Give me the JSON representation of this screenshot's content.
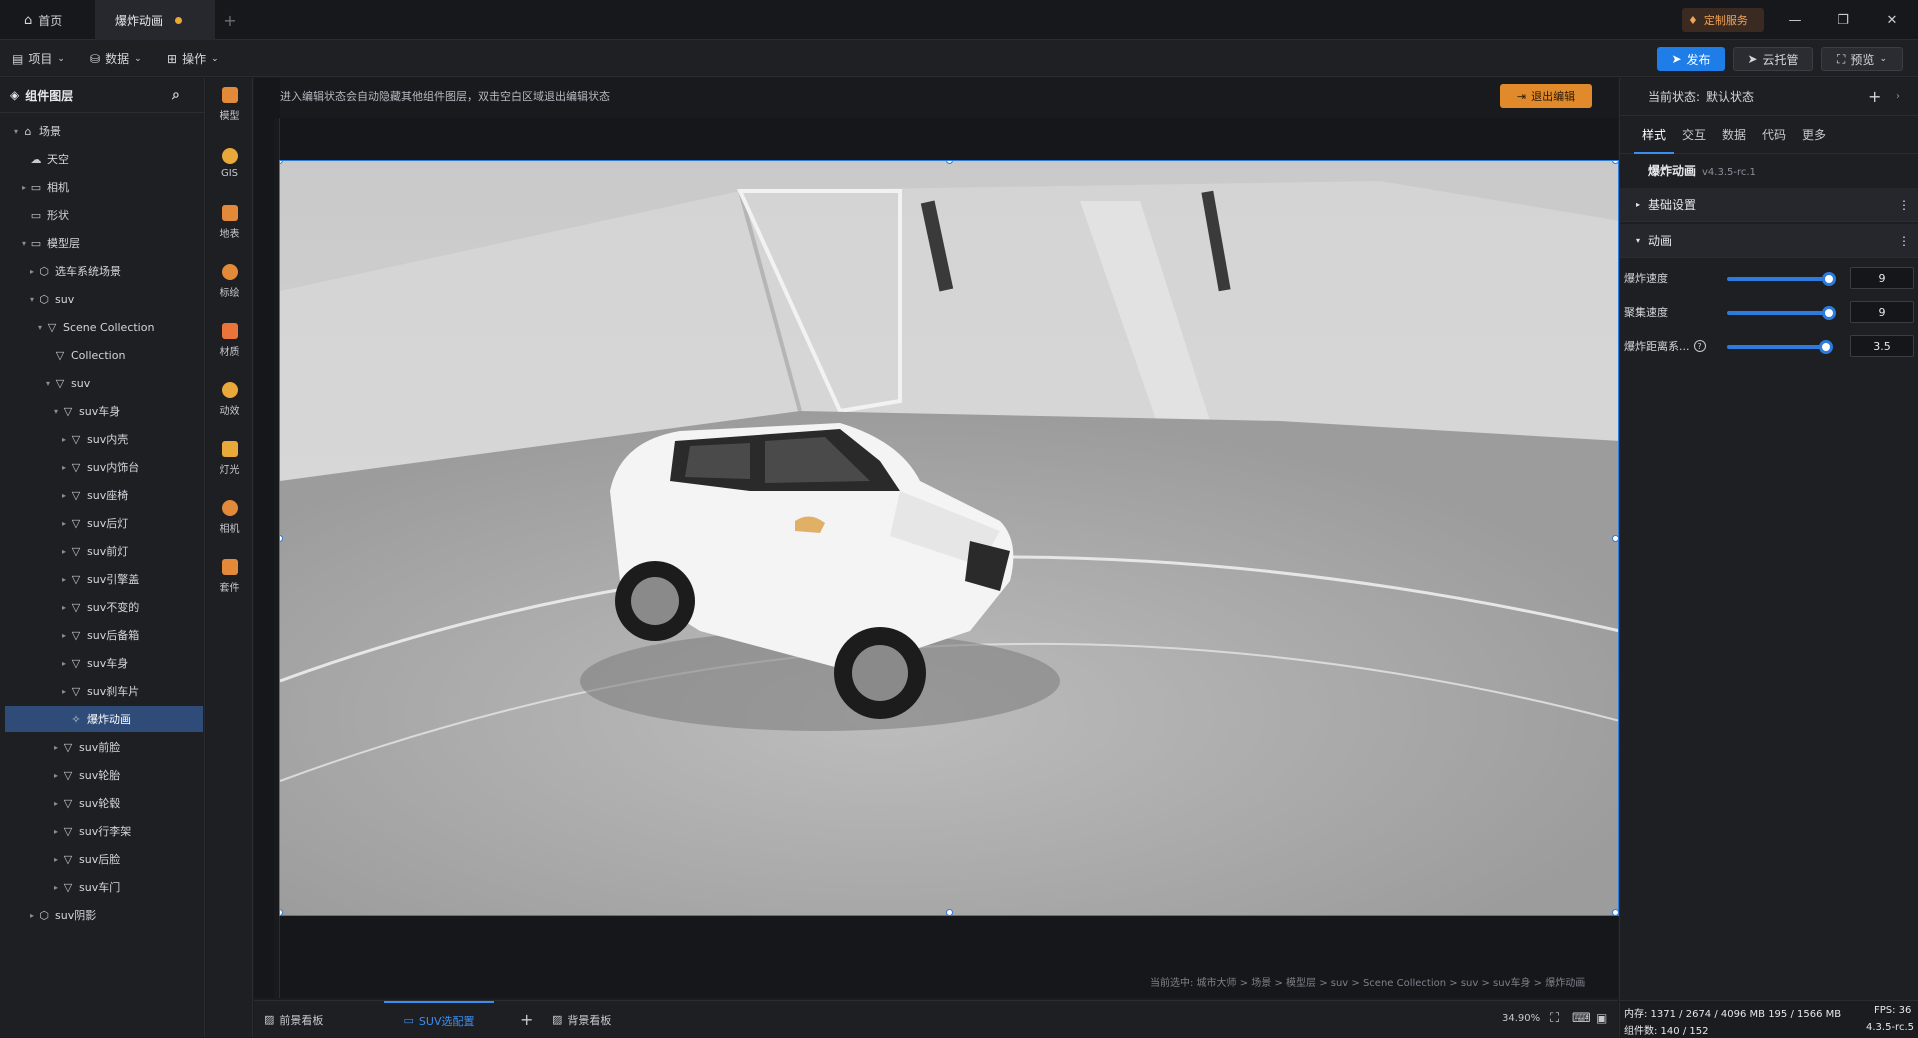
{
  "titlebar": {
    "home_tab": "首页",
    "active_tab": "爆炸动画",
    "custom_service": "定制服务",
    "plus": "+"
  },
  "toolbar": {
    "menu_project": "项目",
    "menu_data": "数据",
    "menu_operation": "操作",
    "publish": "发布",
    "cloud": "云托管",
    "preview": "预览"
  },
  "layers": {
    "title": "组件图层",
    "items": [
      {
        "label": "场景",
        "indent": 0,
        "caret": "▾",
        "icon": "⌂"
      },
      {
        "label": "天空",
        "indent": 1,
        "caret": "",
        "icon": "☁"
      },
      {
        "label": "相机",
        "indent": 1,
        "caret": "▸",
        "icon": "▭"
      },
      {
        "label": "形状",
        "indent": 1,
        "caret": "",
        "icon": "▭"
      },
      {
        "label": "模型层",
        "indent": 1,
        "caret": "▾",
        "icon": "▭"
      },
      {
        "label": "选车系统场景",
        "indent": 2,
        "caret": "▸",
        "icon": "⬡"
      },
      {
        "label": "suv",
        "indent": 2,
        "caret": "▾",
        "icon": "⬡"
      },
      {
        "label": "Scene Collection",
        "indent": 3,
        "caret": "▾",
        "icon": "▽"
      },
      {
        "label": "Collection",
        "indent": 4,
        "caret": "",
        "icon": "▽"
      },
      {
        "label": "suv",
        "indent": 4,
        "caret": "▾",
        "icon": "▽"
      },
      {
        "label": "suv车身",
        "indent": 5,
        "caret": "▾",
        "icon": "▽"
      },
      {
        "label": "suv内壳",
        "indent": 6,
        "caret": "▸",
        "icon": "▽"
      },
      {
        "label": "suv内饰台",
        "indent": 6,
        "caret": "▸",
        "icon": "▽"
      },
      {
        "label": "suv座椅",
        "indent": 6,
        "caret": "▸",
        "icon": "▽"
      },
      {
        "label": "suv后灯",
        "indent": 6,
        "caret": "▸",
        "icon": "▽"
      },
      {
        "label": "suv前灯",
        "indent": 6,
        "caret": "▸",
        "icon": "▽"
      },
      {
        "label": "suv引擎盖",
        "indent": 6,
        "caret": "▸",
        "icon": "▽"
      },
      {
        "label": "suv不变的",
        "indent": 6,
        "caret": "▸",
        "icon": "▽"
      },
      {
        "label": "suv后备箱",
        "indent": 6,
        "caret": "▸",
        "icon": "▽"
      },
      {
        "label": "suv车身",
        "indent": 6,
        "caret": "▸",
        "icon": "▽"
      },
      {
        "label": "suv刹车片",
        "indent": 6,
        "caret": "▸",
        "icon": "▽"
      },
      {
        "label": "爆炸动画",
        "indent": 6,
        "caret": "",
        "icon": "✧",
        "selected": true
      },
      {
        "label": "suv前脸",
        "indent": 5,
        "caret": "▸",
        "icon": "▽"
      },
      {
        "label": "suv轮胎",
        "indent": 5,
        "caret": "▸",
        "icon": "▽"
      },
      {
        "label": "suv轮毂",
        "indent": 5,
        "caret": "▸",
        "icon": "▽"
      },
      {
        "label": "suv行李架",
        "indent": 5,
        "caret": "▸",
        "icon": "▽"
      },
      {
        "label": "suv后脸",
        "indent": 5,
        "caret": "▸",
        "icon": "▽"
      },
      {
        "label": "suv车门",
        "indent": 5,
        "caret": "▸",
        "icon": "▽"
      },
      {
        "label": "suv阴影",
        "indent": 2,
        "caret": "▸",
        "icon": "⬡"
      }
    ]
  },
  "tools": [
    {
      "label": "模型",
      "color": "#e28a3a"
    },
    {
      "label": "GIS",
      "color": "#e9a83a"
    },
    {
      "label": "地表",
      "color": "#e28a3a"
    },
    {
      "label": "标绘",
      "color": "#e28a3a"
    },
    {
      "label": "材质",
      "color": "#e9753a"
    },
    {
      "label": "动效",
      "color": "#e9a83a"
    },
    {
      "label": "灯光",
      "color": "#e9a83a"
    },
    {
      "label": "相机",
      "color": "#e28a3a"
    },
    {
      "label": "套件",
      "color": "#e28a3a"
    }
  ],
  "canvas": {
    "hint": "进入编辑状态会自动隐藏其他组件图层，双击空白区域退出编辑状态",
    "exit_edit": "退出编辑",
    "breadcrumb": "当前选中: 城市大师 > 场景 > 模型层 > suv > Scene Collection > suv > suv车身 > 爆炸动画"
  },
  "bottombar": {
    "tab_foreground": "前景看板",
    "tab_suv": "SUV选配置",
    "tab_background": "背景看板",
    "zoom": "34.90%"
  },
  "props": {
    "current_state_label": "当前状态:",
    "current_state_value": "默认状态",
    "tabs": [
      "样式",
      "交互",
      "数据",
      "代码",
      "更多"
    ],
    "component_name": "爆炸动画",
    "component_version": "v4.3.5-rc.1",
    "section_basic": "基础设置",
    "section_animation": "动画",
    "fields": [
      {
        "label": "爆炸速度",
        "value": "9",
        "level": 1.0
      },
      {
        "label": "聚集速度",
        "value": "9",
        "level": 1.0
      },
      {
        "label": "爆炸距离系...",
        "value": "3.5",
        "level": 0.97
      }
    ]
  },
  "stats": {
    "memory": "内存:  1371 / 2674 / 4096 MB  195 / 1566 MB",
    "components": "组件数: 140 / 152",
    "fps": "FPS:  36",
    "version": "4.3.5-rc.5"
  }
}
